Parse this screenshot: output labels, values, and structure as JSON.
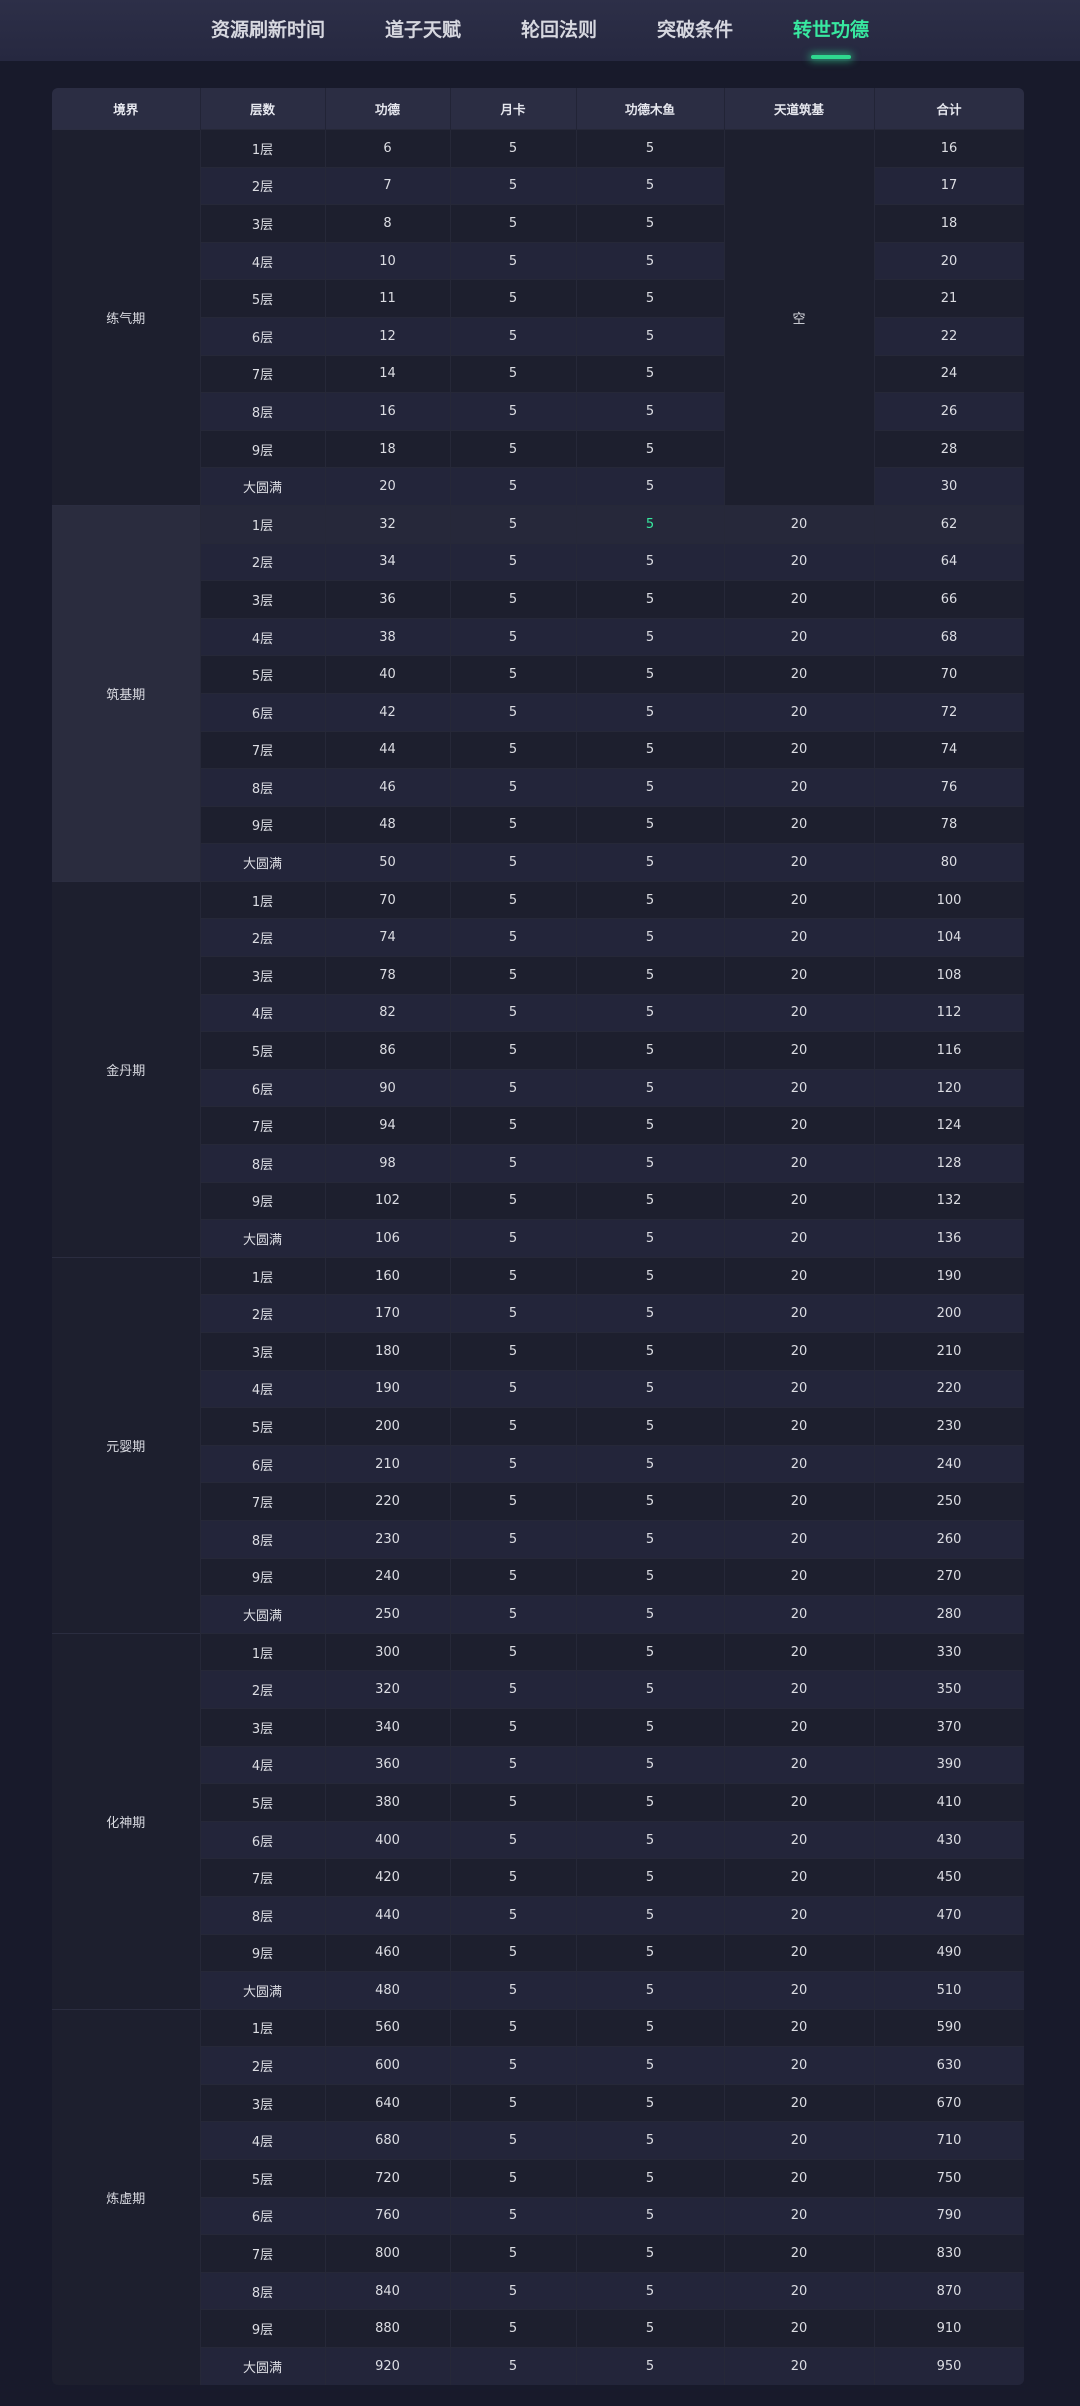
{
  "tabs": [
    {
      "label": "资源刷新时间",
      "active": false
    },
    {
      "label": "道子天赋",
      "active": false
    },
    {
      "label": "轮回法则",
      "active": false
    },
    {
      "label": "突破条件",
      "active": false
    },
    {
      "label": "转世功德",
      "active": true
    }
  ],
  "table": {
    "headers": [
      "境界",
      "层数",
      "功德",
      "月卡",
      "功德木鱼",
      "天道筑基",
      "合计"
    ],
    "empty_label": "空",
    "realms": [
      {
        "name": "练气期",
        "tianyou": null,
        "rows": [
          [
            "1层",
            "6",
            "5",
            "5",
            "16"
          ],
          [
            "2层",
            "7",
            "5",
            "5",
            "17"
          ],
          [
            "3层",
            "8",
            "5",
            "5",
            "18"
          ],
          [
            "4层",
            "10",
            "5",
            "5",
            "20"
          ],
          [
            "5层",
            "11",
            "5",
            "5",
            "21"
          ],
          [
            "6层",
            "12",
            "5",
            "5",
            "22"
          ],
          [
            "7层",
            "14",
            "5",
            "5",
            "24"
          ],
          [
            "8层",
            "16",
            "5",
            "5",
            "26"
          ],
          [
            "9层",
            "18",
            "5",
            "5",
            "28"
          ],
          [
            "大圆满",
            "20",
            "5",
            "5",
            "30"
          ]
        ]
      },
      {
        "name": "筑基期",
        "tianyou": "20",
        "rows": [
          [
            "1层",
            "32",
            "5",
            "5",
            "62"
          ],
          [
            "2层",
            "34",
            "5",
            "5",
            "64"
          ],
          [
            "3层",
            "36",
            "5",
            "5",
            "66"
          ],
          [
            "4层",
            "38",
            "5",
            "5",
            "68"
          ],
          [
            "5层",
            "40",
            "5",
            "5",
            "70"
          ],
          [
            "6层",
            "42",
            "5",
            "5",
            "72"
          ],
          [
            "7层",
            "44",
            "5",
            "5",
            "74"
          ],
          [
            "8层",
            "46",
            "5",
            "5",
            "76"
          ],
          [
            "9层",
            "48",
            "5",
            "5",
            "78"
          ],
          [
            "大圆满",
            "50",
            "5",
            "5",
            "80"
          ]
        ]
      },
      {
        "name": "金丹期",
        "tianyou": "20",
        "rows": [
          [
            "1层",
            "70",
            "5",
            "5",
            "100"
          ],
          [
            "2层",
            "74",
            "5",
            "5",
            "104"
          ],
          [
            "3层",
            "78",
            "5",
            "5",
            "108"
          ],
          [
            "4层",
            "82",
            "5",
            "5",
            "112"
          ],
          [
            "5层",
            "86",
            "5",
            "5",
            "116"
          ],
          [
            "6层",
            "90",
            "5",
            "5",
            "120"
          ],
          [
            "7层",
            "94",
            "5",
            "5",
            "124"
          ],
          [
            "8层",
            "98",
            "5",
            "5",
            "128"
          ],
          [
            "9层",
            "102",
            "5",
            "5",
            "132"
          ],
          [
            "大圆满",
            "106",
            "5",
            "5",
            "136"
          ]
        ]
      },
      {
        "name": "元婴期",
        "tianyou": "20",
        "rows": [
          [
            "1层",
            "160",
            "5",
            "5",
            "190"
          ],
          [
            "2层",
            "170",
            "5",
            "5",
            "200"
          ],
          [
            "3层",
            "180",
            "5",
            "5",
            "210"
          ],
          [
            "4层",
            "190",
            "5",
            "5",
            "220"
          ],
          [
            "5层",
            "200",
            "5",
            "5",
            "230"
          ],
          [
            "6层",
            "210",
            "5",
            "5",
            "240"
          ],
          [
            "7层",
            "220",
            "5",
            "5",
            "250"
          ],
          [
            "8层",
            "230",
            "5",
            "5",
            "260"
          ],
          [
            "9层",
            "240",
            "5",
            "5",
            "270"
          ],
          [
            "大圆满",
            "250",
            "5",
            "5",
            "280"
          ]
        ]
      },
      {
        "name": "化神期",
        "tianyou": "20",
        "rows": [
          [
            "1层",
            "300",
            "5",
            "5",
            "330"
          ],
          [
            "2层",
            "320",
            "5",
            "5",
            "350"
          ],
          [
            "3层",
            "340",
            "5",
            "5",
            "370"
          ],
          [
            "4层",
            "360",
            "5",
            "5",
            "390"
          ],
          [
            "5层",
            "380",
            "5",
            "5",
            "410"
          ],
          [
            "6层",
            "400",
            "5",
            "5",
            "430"
          ],
          [
            "7层",
            "420",
            "5",
            "5",
            "450"
          ],
          [
            "8层",
            "440",
            "5",
            "5",
            "470"
          ],
          [
            "9层",
            "460",
            "5",
            "5",
            "490"
          ],
          [
            "大圆满",
            "480",
            "5",
            "5",
            "510"
          ]
        ]
      },
      {
        "name": "炼虚期",
        "tianyou": "20",
        "rows": [
          [
            "1层",
            "560",
            "5",
            "5",
            "590"
          ],
          [
            "2层",
            "600",
            "5",
            "5",
            "630"
          ],
          [
            "3层",
            "640",
            "5",
            "5",
            "670"
          ],
          [
            "4层",
            "680",
            "5",
            "5",
            "710"
          ],
          [
            "5层",
            "720",
            "5",
            "5",
            "750"
          ],
          [
            "6层",
            "760",
            "5",
            "5",
            "790"
          ],
          [
            "7层",
            "800",
            "5",
            "5",
            "830"
          ],
          [
            "8层",
            "840",
            "5",
            "5",
            "870"
          ],
          [
            "9层",
            "880",
            "5",
            "5",
            "910"
          ],
          [
            "大圆满",
            "920",
            "5",
            "5",
            "950"
          ]
        ]
      }
    ]
  },
  "colors": {
    "accent": "#37e79e",
    "background": "#181a2b",
    "header": "#2b2d43"
  }
}
